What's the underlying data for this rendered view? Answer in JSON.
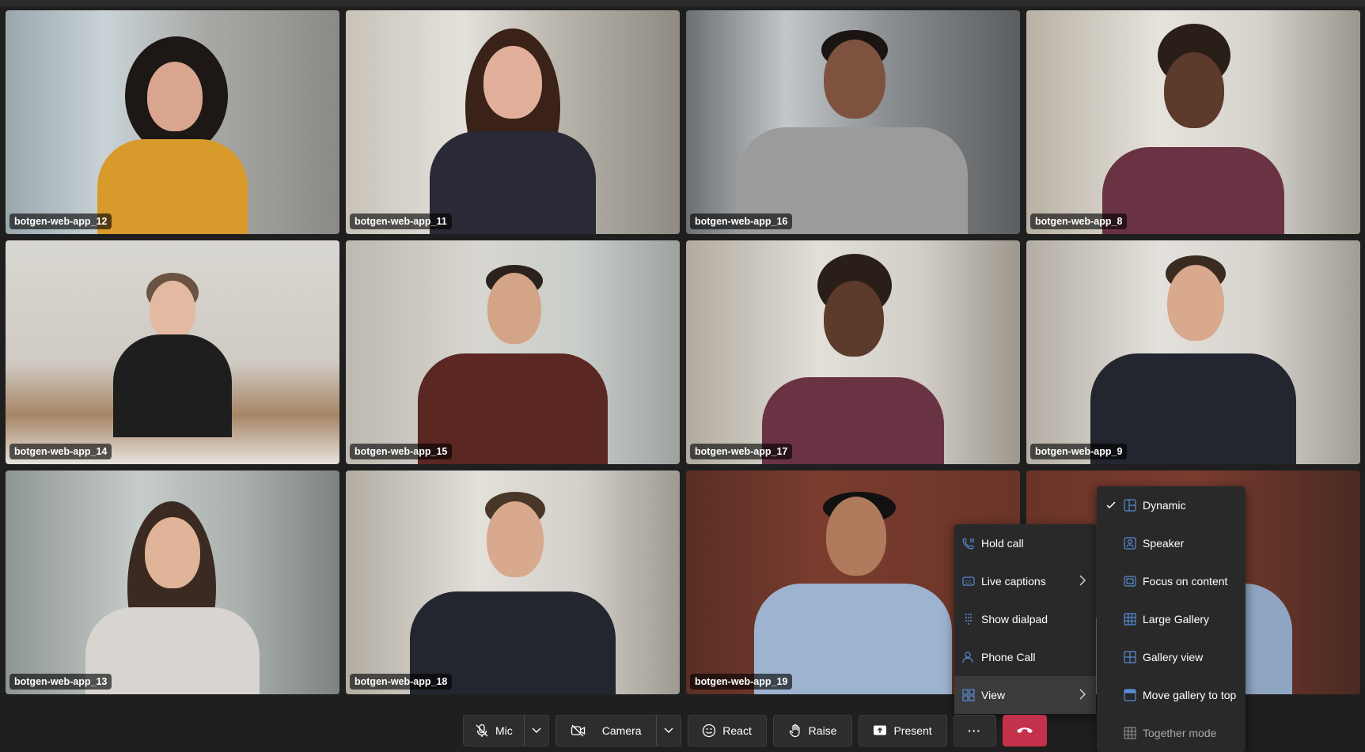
{
  "participants": [
    {
      "name": "botgen-web-app_12"
    },
    {
      "name": "botgen-web-app_11"
    },
    {
      "name": "botgen-web-app_16"
    },
    {
      "name": "botgen-web-app_8"
    },
    {
      "name": "botgen-web-app_14"
    },
    {
      "name": "botgen-web-app_15"
    },
    {
      "name": "botgen-web-app_17"
    },
    {
      "name": "botgen-web-app_9"
    },
    {
      "name": "botgen-web-app_13"
    },
    {
      "name": "botgen-web-app_18"
    },
    {
      "name": "botgen-web-app_19"
    }
  ],
  "more_menu": {
    "items": [
      {
        "label": "Hold call",
        "icon": "hold-icon"
      },
      {
        "label": "Live captions",
        "icon": "captions-icon"
      },
      {
        "label": "Show dialpad",
        "icon": "dialpad-icon"
      },
      {
        "label": "Phone Call",
        "icon": "phone-icon"
      },
      {
        "label": "View",
        "icon": "view-grid-icon"
      }
    ]
  },
  "view_submenu": {
    "items": [
      {
        "label": "Dynamic",
        "icon": "dynamic-icon",
        "checked": true
      },
      {
        "label": "Speaker",
        "icon": "speaker-icon"
      },
      {
        "label": "Focus on content",
        "icon": "focus-content-icon"
      },
      {
        "label": "Large Gallery",
        "icon": "large-gallery-icon"
      },
      {
        "label": "Gallery view",
        "icon": "gallery-view-icon"
      },
      {
        "label": "Move gallery to top",
        "icon": "gallery-top-icon"
      },
      {
        "label": "Together mode",
        "icon": "together-mode-icon",
        "disabled": true
      }
    ]
  },
  "toolbar": {
    "mic_label": "Mic",
    "camera_label": "Camera",
    "react_label": "React",
    "raise_label": "Raise",
    "present_label": "Present",
    "more_label": "···"
  },
  "colors": {
    "background": "#1f1f1f",
    "accent": "#5b8cd6",
    "hangup": "#c4314b"
  }
}
